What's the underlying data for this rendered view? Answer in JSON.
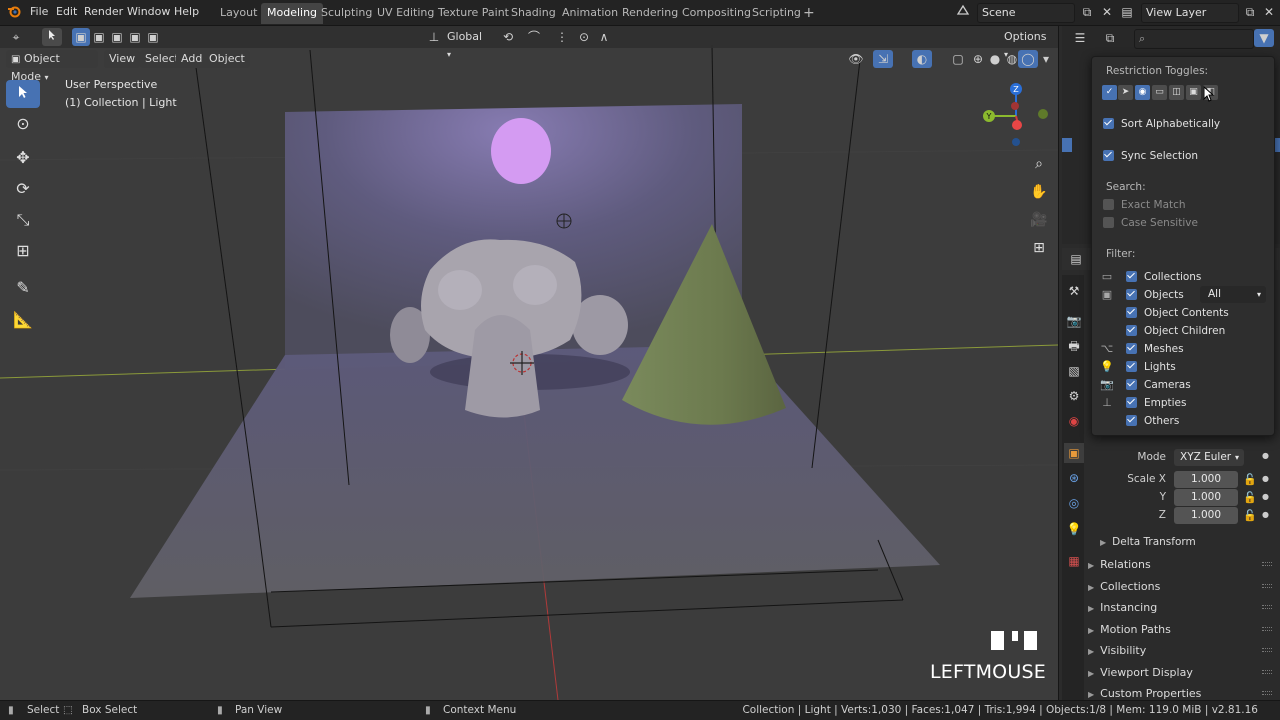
{
  "menu": {
    "items": [
      "File",
      "Edit",
      "Render",
      "Window",
      "Help"
    ],
    "workspaces": [
      "Layout",
      "Modeling",
      "Sculpting",
      "UV Editing",
      "Texture Paint",
      "Shading",
      "Animation",
      "Rendering",
      "Compositing",
      "Scripting"
    ],
    "active_workspace": "Modeling",
    "add_tab": "+",
    "scene": "Scene",
    "view_layer": "View Layer"
  },
  "viewport_header": {
    "orientation": "Global",
    "options": "Options",
    "mode": "Object Mode",
    "menus": [
      "View",
      "Select",
      "Add",
      "Object"
    ]
  },
  "viewport": {
    "perspective": "User Perspective",
    "collection_info": "(1) Collection | Light",
    "key_display": "LEFTMOUSE",
    "gizmo_axes": {
      "x": "X",
      "y": "Y",
      "z": "Z"
    }
  },
  "popup": {
    "restriction_title": "Restriction Toggles:",
    "sort_alphabetically": "Sort Alphabetically",
    "sync_selection": "Sync Selection",
    "search_title": "Search:",
    "exact_match": "Exact Match",
    "case_sensitive": "Case Sensitive",
    "filter_title": "Filter:",
    "filters": [
      {
        "label": "Collections",
        "checked": true,
        "icon": "collection-icon"
      },
      {
        "label": "Objects",
        "checked": true,
        "icon": "object-icon"
      },
      {
        "label": "Object Contents",
        "checked": true,
        "icon": ""
      },
      {
        "label": "Object Children",
        "checked": true,
        "icon": ""
      },
      {
        "label": "Meshes",
        "checked": true,
        "icon": "mesh-icon"
      },
      {
        "label": "Lights",
        "checked": true,
        "icon": "light-icon"
      },
      {
        "label": "Cameras",
        "checked": true,
        "icon": "camera-icon"
      },
      {
        "label": "Empties",
        "checked": true,
        "icon": "empty-icon"
      },
      {
        "label": "Others",
        "checked": true,
        "icon": ""
      }
    ],
    "objects_dropdown": "All"
  },
  "properties": {
    "mode_label": "Mode",
    "mode_value": "XYZ Euler",
    "scale": [
      {
        "label": "Scale X",
        "value": "1.000"
      },
      {
        "label": "Y",
        "value": "1.000"
      },
      {
        "label": "Z",
        "value": "1.000"
      }
    ],
    "delta_transform": "Delta Transform",
    "panels": [
      "Relations",
      "Collections",
      "Instancing",
      "Motion Paths",
      "Visibility",
      "Viewport Display",
      "Custom Properties"
    ]
  },
  "statusbar": {
    "select": "Select",
    "box_select": "Box Select",
    "pan_view": "Pan View",
    "context_menu": "Context Menu",
    "stats": "Collection | Light | Verts:1,030 | Faces:1,047 | Tris:1,994 | Objects:1/8 | Mem: 119.0 MiB | v2.81.16"
  },
  "colors": {
    "accent": "#4772b3",
    "light_disc": "#d49bf2",
    "cone": "#6f7a52",
    "monkey": "#a8a4ad",
    "viewport_bg": "#3c3c3c"
  }
}
